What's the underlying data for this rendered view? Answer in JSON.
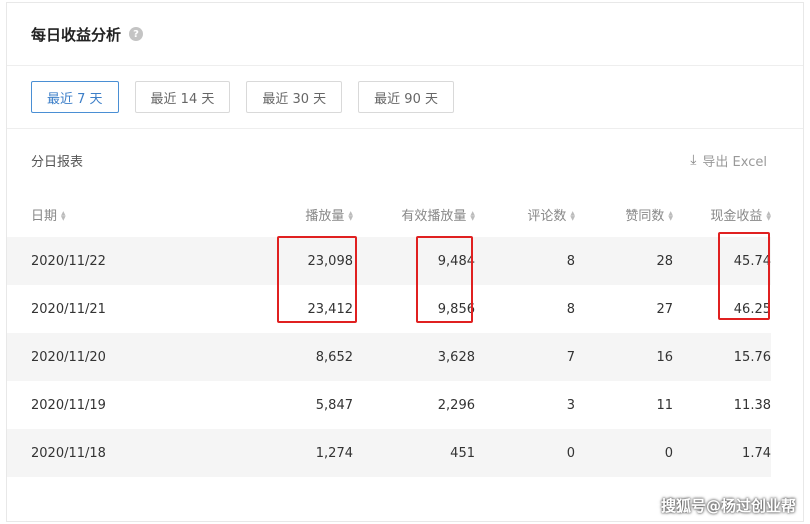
{
  "card": {
    "title": "每日收益分析",
    "help_glyph": "?"
  },
  "range_tabs": [
    {
      "label": "最近 7 天",
      "active": true
    },
    {
      "label": "最近 14 天",
      "active": false
    },
    {
      "label": "最近 30 天",
      "active": false
    },
    {
      "label": "最近 90 天",
      "active": false
    }
  ],
  "report": {
    "title": "分日报表",
    "export_label": "导出 Excel"
  },
  "table": {
    "columns": [
      "日期",
      "播放量",
      "有效播放量",
      "评论数",
      "赞同数",
      "现金收益"
    ],
    "rows": [
      [
        "2020/11/22",
        "23,098",
        "9,484",
        "8",
        "28",
        "45.74"
      ],
      [
        "2020/11/21",
        "23,412",
        "9,856",
        "8",
        "27",
        "46.25"
      ],
      [
        "2020/11/20",
        "8,652",
        "3,628",
        "7",
        "16",
        "15.76"
      ],
      [
        "2020/11/19",
        "5,847",
        "2,296",
        "3",
        "11",
        "11.38"
      ],
      [
        "2020/11/18",
        "1,274",
        "451",
        "0",
        "0",
        "1.74"
      ]
    ]
  },
  "watermark": "搜狐号@杨过创业帮",
  "colors": {
    "accent": "#3d7fc8",
    "highlight_box": "#e02020",
    "row_shade": "#f5f5f5"
  }
}
